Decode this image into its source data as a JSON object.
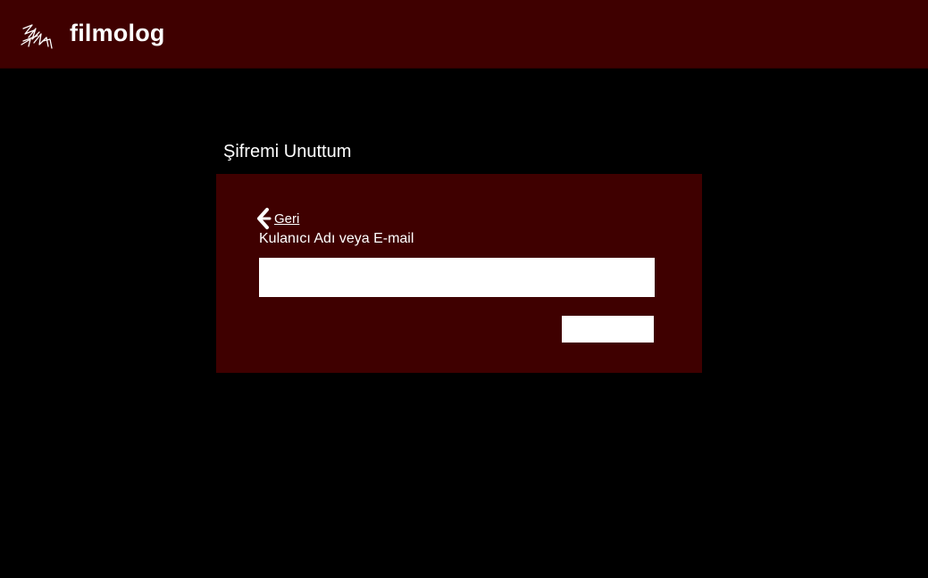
{
  "header": {
    "brand": "filmolog",
    "logo_icon": "film-director-sketch-icon",
    "background": "#3f0000"
  },
  "page": {
    "title": "Şifremi Unuttum"
  },
  "form": {
    "back_label": "Geri",
    "back_icon": "arrow-left-icon",
    "field_label": "Kulanıcı Adı veya E-mail",
    "field_value": "",
    "field_placeholder": "",
    "submit_label": "",
    "panel_color": "#3f0000"
  }
}
